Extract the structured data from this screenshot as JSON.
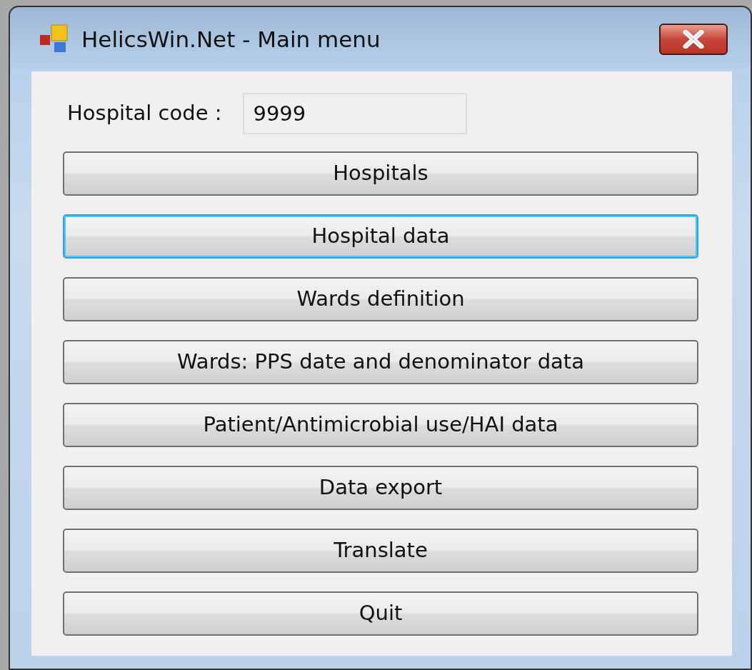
{
  "window": {
    "title": "HelicsWin.Net - Main menu"
  },
  "hospital_code": {
    "label": "Hospital code :",
    "value": "9999"
  },
  "buttons": [
    {
      "label": "Hospitals",
      "focused": false
    },
    {
      "label": "Hospital data",
      "focused": true
    },
    {
      "label": "Wards definition",
      "focused": false
    },
    {
      "label": "Wards: PPS date and denominator data",
      "focused": false
    },
    {
      "label": "Patient/Antimicrobial use/HAI data",
      "focused": false
    },
    {
      "label": "Data export",
      "focused": false
    },
    {
      "label": "Translate",
      "focused": false
    },
    {
      "label": "Quit",
      "focused": false
    }
  ]
}
